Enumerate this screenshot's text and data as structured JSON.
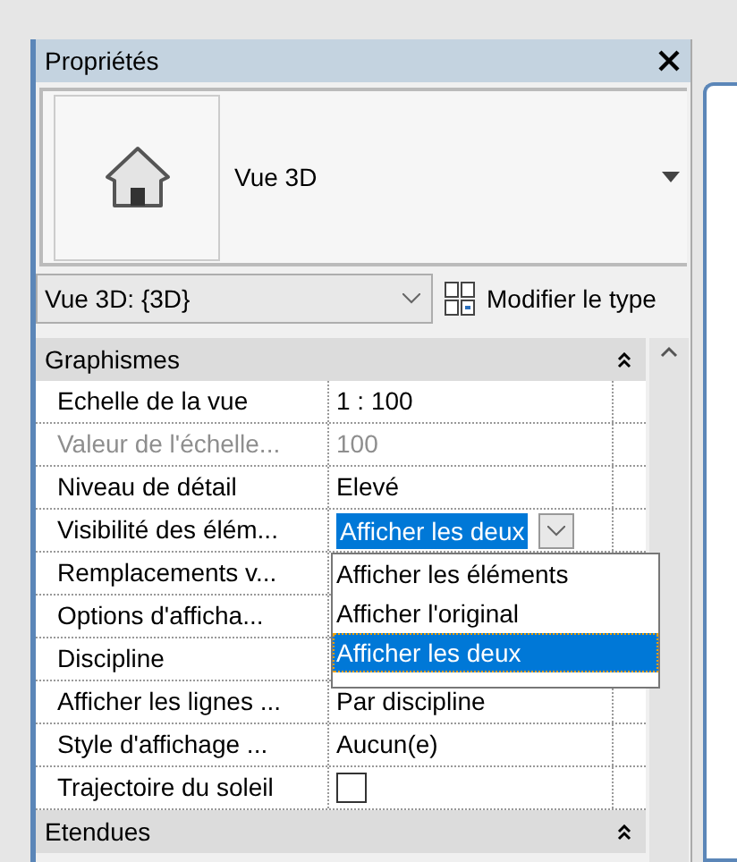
{
  "panel": {
    "title": "Propriétés"
  },
  "type_selector": {
    "name": "Vue 3D"
  },
  "instance": {
    "value": "Vue 3D: {3D}",
    "edit_type": "Modifier le type"
  },
  "groups": [
    {
      "title": "Graphismes",
      "expanded": true,
      "rows": [
        {
          "name": "Echelle de la vue",
          "value": "1 : 100",
          "kind": "text",
          "disabled": false
        },
        {
          "name": "Valeur de l'échelle...",
          "value": "100",
          "kind": "text",
          "disabled": true
        },
        {
          "name": "Niveau de détail",
          "value": "Elevé",
          "kind": "text",
          "disabled": false
        },
        {
          "name": "Visibilité des élém...",
          "value": "Afficher les deux",
          "kind": "select",
          "disabled": false
        },
        {
          "name": "Remplacements v...",
          "kind": "hidden",
          "disabled": false
        },
        {
          "name": "Options d'afficha...",
          "kind": "hidden",
          "disabled": false
        },
        {
          "name": "Discipline",
          "kind": "hidden",
          "disabled": false
        },
        {
          "name": "Afficher les lignes ...",
          "value": "Par discipline",
          "kind": "text",
          "disabled": false
        },
        {
          "name": "Style d'affichage ...",
          "value": "Aucun(e)",
          "kind": "text",
          "disabled": false
        },
        {
          "name": "Trajectoire du soleil",
          "kind": "checkbox",
          "checked": false,
          "disabled": false
        }
      ]
    },
    {
      "title": "Etendues",
      "expanded": true
    }
  ],
  "dropdown": {
    "options": [
      {
        "label": "Afficher les éléments",
        "selected": false
      },
      {
        "label": "Afficher l'original",
        "selected": false
      },
      {
        "label": "Afficher les deux",
        "selected": true
      }
    ]
  }
}
